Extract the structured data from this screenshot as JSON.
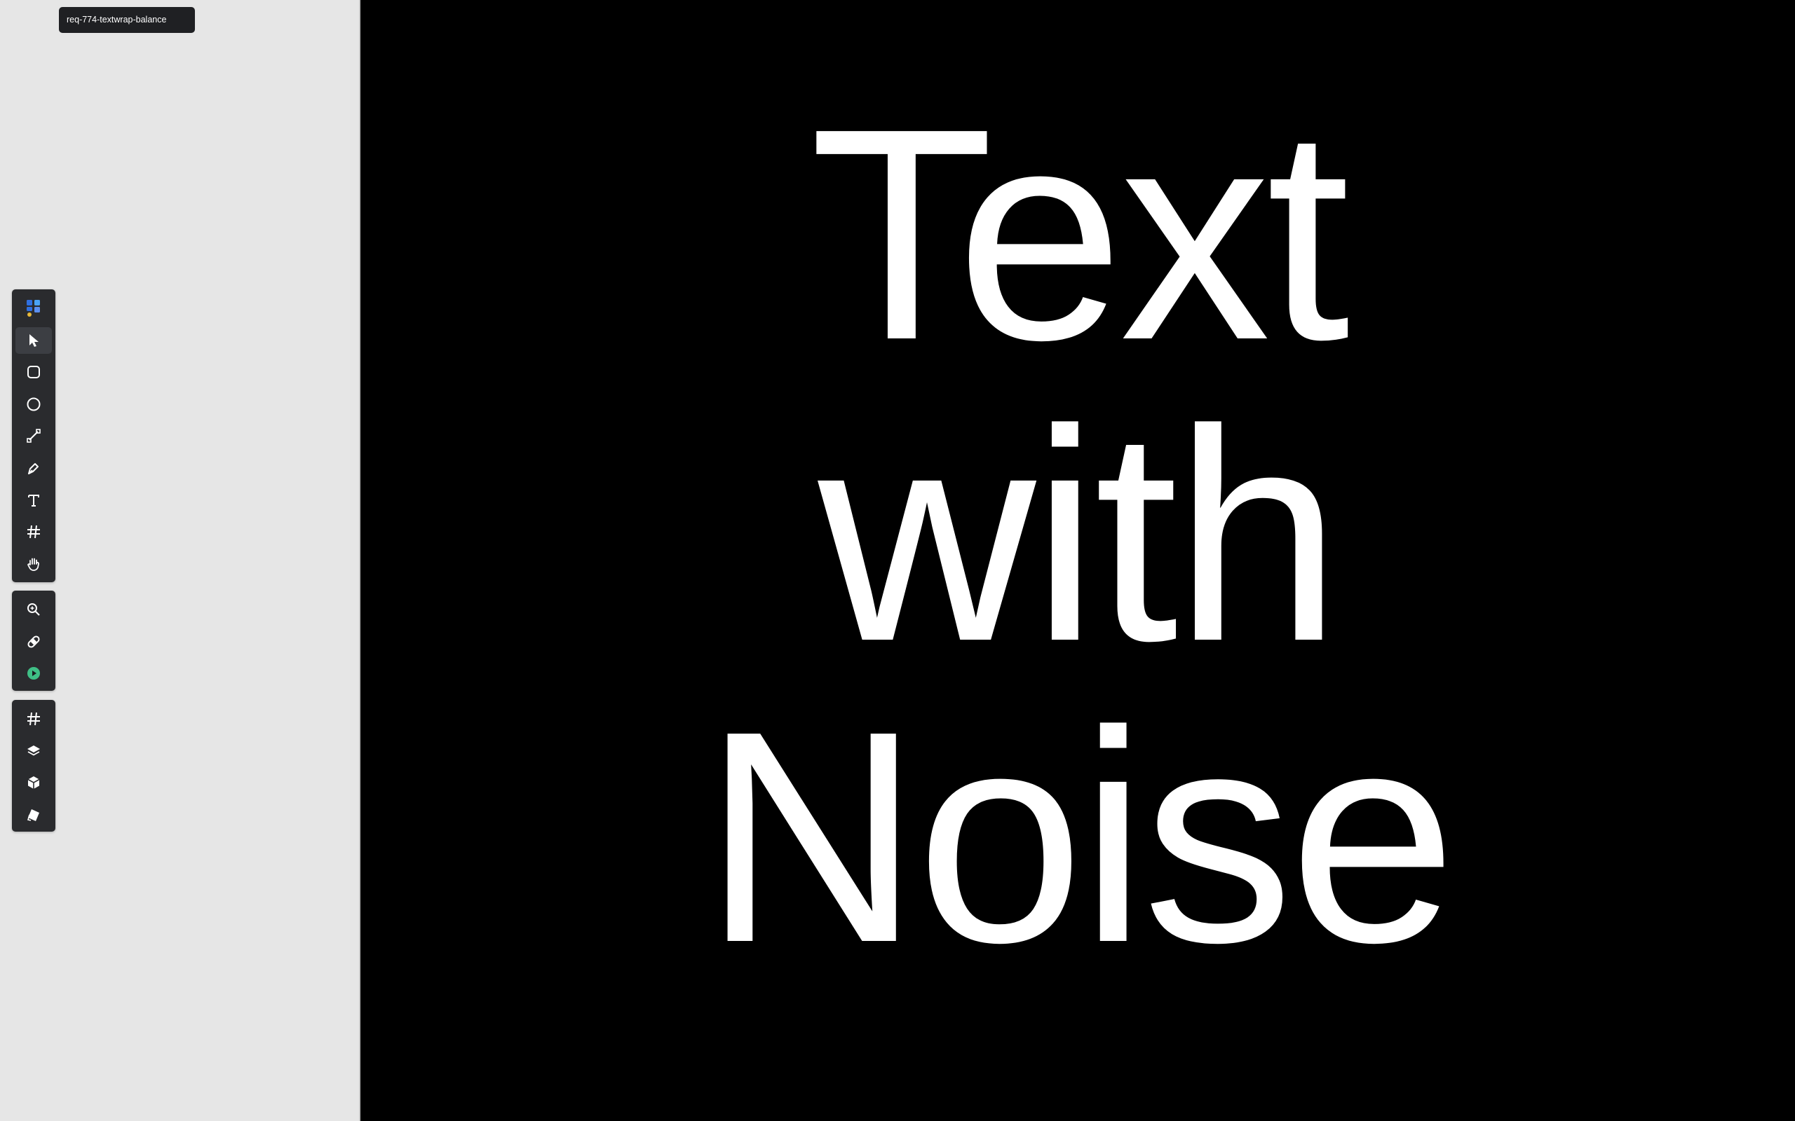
{
  "file_tab": {
    "name": "req-774-textwrap-balance"
  },
  "toolbar_main": {
    "tools": [
      {
        "icon": "app-logo-icon"
      },
      {
        "icon": "pointer-icon",
        "active": true
      },
      {
        "icon": "rectangle-icon"
      },
      {
        "icon": "ellipse-icon"
      },
      {
        "icon": "line-icon"
      },
      {
        "icon": "pen-icon"
      },
      {
        "icon": "text-icon"
      },
      {
        "icon": "frame-icon"
      },
      {
        "icon": "hand-icon"
      }
    ]
  },
  "toolbar_view": {
    "tools": [
      {
        "icon": "zoom-icon"
      },
      {
        "icon": "bandage-icon"
      },
      {
        "icon": "play-icon",
        "color": "#3fbf86"
      }
    ]
  },
  "toolbar_panels": {
    "tools": [
      {
        "icon": "grid-icon"
      },
      {
        "icon": "layers-icon"
      },
      {
        "icon": "component-icon"
      },
      {
        "icon": "paint-icon"
      }
    ]
  },
  "canvas": {
    "background": "#000000",
    "text_color": "#ffffff",
    "text_lines": [
      "Text",
      "with",
      "Noise"
    ]
  }
}
